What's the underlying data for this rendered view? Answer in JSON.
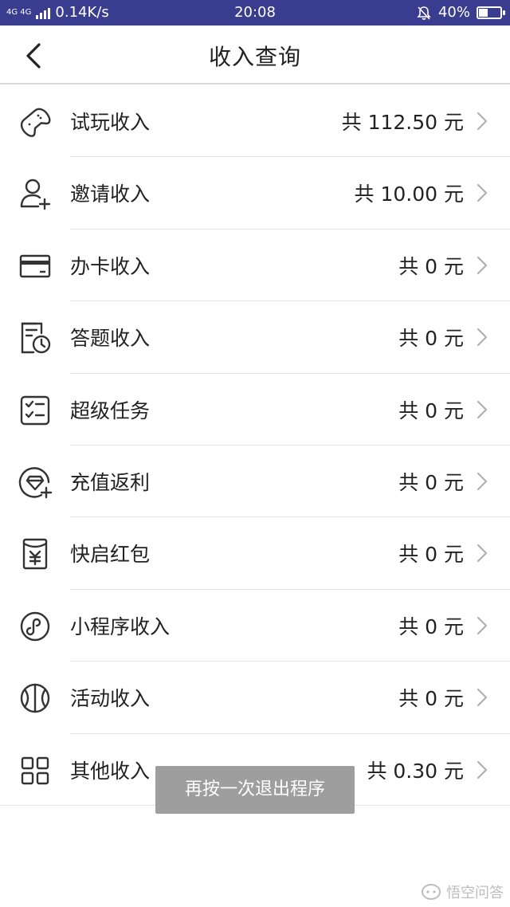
{
  "status_bar": {
    "network_type": "4G 4G",
    "speed": "0.14K/s",
    "time": "20:08",
    "battery": "40%",
    "battery_level": 0.4
  },
  "header": {
    "title": "收入查询"
  },
  "items": [
    {
      "icon": "gamepad-icon",
      "label": "试玩收入",
      "amount": "共 112.50 元"
    },
    {
      "icon": "add-user-icon",
      "label": "邀请收入",
      "amount": "共 10.00 元"
    },
    {
      "icon": "card-icon",
      "label": "办卡收入",
      "amount": "共 0 元"
    },
    {
      "icon": "quiz-clock-icon",
      "label": "答题收入",
      "amount": "共 0 元"
    },
    {
      "icon": "checklist-icon",
      "label": "超级任务",
      "amount": "共 0 元"
    },
    {
      "icon": "diamond-add-icon",
      "label": "充值返利",
      "amount": "共 0 元"
    },
    {
      "icon": "red-envelope-icon",
      "label": "快启红包",
      "amount": "共 0 元"
    },
    {
      "icon": "mini-program-icon",
      "label": "小程序收入",
      "amount": "共 0 元"
    },
    {
      "icon": "basketball-icon",
      "label": "活动收入",
      "amount": "共 0 元"
    },
    {
      "icon": "grid-icon",
      "label": "其他收入",
      "amount": "共 0.30 元"
    }
  ],
  "toast": {
    "text": "再按一次退出程序"
  },
  "watermark": {
    "text": "悟空问答"
  },
  "colors": {
    "status_bar_bg": "#3a3d8f",
    "text": "#222222",
    "chevron": "#b0b0b0",
    "toast_bg": "#9e9e9e"
  }
}
